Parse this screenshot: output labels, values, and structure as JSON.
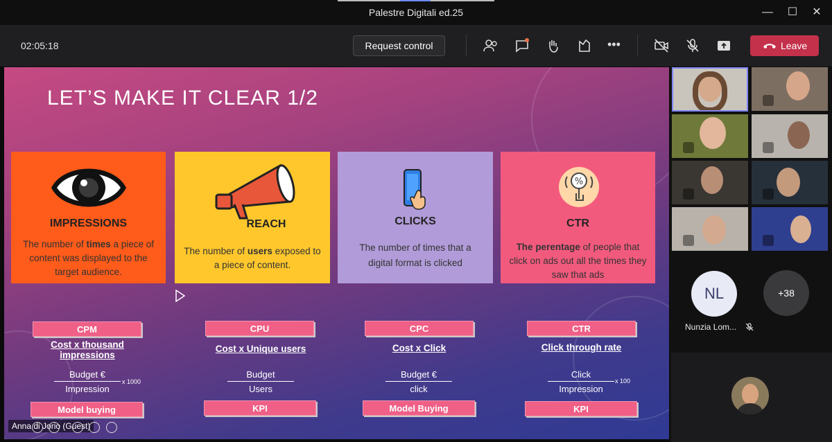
{
  "window": {
    "title": "Palestre Digitali ed.25"
  },
  "toolbar": {
    "timer": "02:05:18",
    "request_control": "Request control",
    "leave": "Leave"
  },
  "slide": {
    "title": "LET’S MAKE IT CLEAR 1/2",
    "cards": [
      {
        "title": "IMPRESSIONS",
        "desc_a": "The number of ",
        "desc_b": "times",
        "desc_c": " a piece of content was displayed to the target audience.",
        "color": "#ff5b1a"
      },
      {
        "title": "REACH",
        "desc_a": "The number of ",
        "desc_b": "users",
        "desc_c": " exposed to a piece of content.",
        "color": "#ffc72c"
      },
      {
        "title": "CLICKS",
        "desc_a": "The number of times that a digital format is clicked",
        "desc_b": "",
        "desc_c": "",
        "color": "#b19bd8"
      },
      {
        "title": "CTR",
        "desc_a": "",
        "desc_b": "The perentage",
        "desc_c": " of people that click on ads out all the times they saw that ads",
        "color": "#f25a7d"
      }
    ],
    "metrics": [
      {
        "acronym": "CPM",
        "full": "Cost x thousand impressions",
        "num": "Budget €",
        "den": "Impression",
        "mult": "x 1000",
        "tag": "Model buying"
      },
      {
        "acronym": "CPU",
        "full": "Cost x Unique users",
        "num": "Budget",
        "den": "Users",
        "mult": "",
        "tag": "KPI"
      },
      {
        "acronym": "CPC",
        "full": "Cost x Click",
        "num": "Budget €",
        "den": "click",
        "mult": "",
        "tag": "Model Buying"
      },
      {
        "acronym": "CTR",
        "full": "Click through rate",
        "num": "Click",
        "den": "Impression",
        "mult": "x 100",
        "tag": "KPI"
      }
    ]
  },
  "presenter": "Anna di Jorio (Guest)",
  "participants": {
    "nl_initials": "NL",
    "nl_name": "Nunzia Lom...",
    "more_count": "+38"
  },
  "colors": {
    "leave": "#c4314b",
    "pill": "#ef5f86",
    "accent": "#6b8cff"
  }
}
